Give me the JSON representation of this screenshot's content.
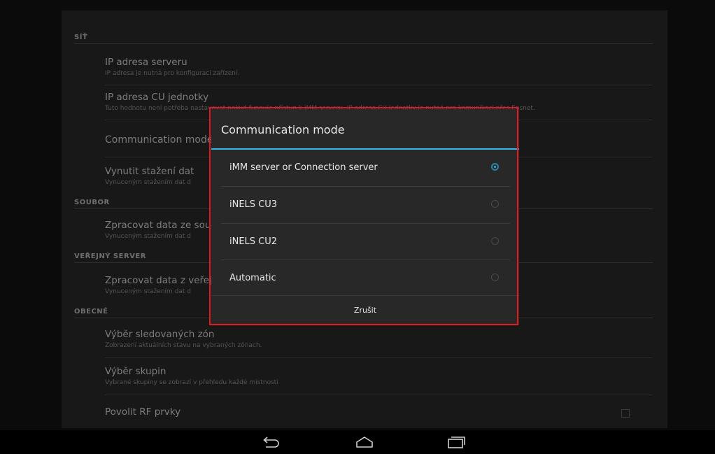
{
  "settings": {
    "sections": {
      "sit": "SÍŤ",
      "soubor": "SOUBOR",
      "verejny_server": "VEŘEJNÝ SERVER",
      "obecne": "OBECNÉ"
    },
    "items": {
      "ip_server": {
        "title": "IP adresa serveru",
        "summary": "IP adresa je nutná pro konfiguraci zařízení."
      },
      "ip_cu": {
        "title": "IP adresa CU jednotky",
        "summary": "Tuto hodnotu není potřeba nastavovat pokud funguje přístup k iMM serveru. IP adresa CU jednotky je nutná pro komunikaci přes Epsnet."
      },
      "comm_mode": {
        "title": "Communication mode"
      },
      "force_download": {
        "title": "Vynutit stažení dat",
        "summary": "Vynuceným stažením dat d"
      },
      "process_file": {
        "title": "Zpracovat data ze sou",
        "summary": "Vynuceným stažením dat d"
      },
      "process_public": {
        "title": "Zpracovat data z veřej",
        "summary": "Vynuceným stažením dat d"
      },
      "zones": {
        "title": "Výběr sledovaných zón",
        "summary": "Zobrazení aktuálních stavu na vybraných zónach."
      },
      "groups": {
        "title": "Výběr skupin",
        "summary": "Vybrané skupiny se zobrazí v přehledu každé místnosti"
      },
      "rf": {
        "title": "Povolit RF prvky"
      }
    }
  },
  "dialog": {
    "title": "Communication mode",
    "options": [
      {
        "label": "iMM server or Connection server",
        "selected": true
      },
      {
        "label": "iNELS CU3",
        "selected": false
      },
      {
        "label": "iNELS CU2",
        "selected": false
      },
      {
        "label": "Automatic",
        "selected": false
      }
    ],
    "cancel_label": "Zrušit",
    "accent_color": "#33b5e5",
    "highlight_color": "#e01b24"
  },
  "navbar": {
    "buttons": [
      "back-icon",
      "home-icon",
      "recents-icon"
    ]
  }
}
